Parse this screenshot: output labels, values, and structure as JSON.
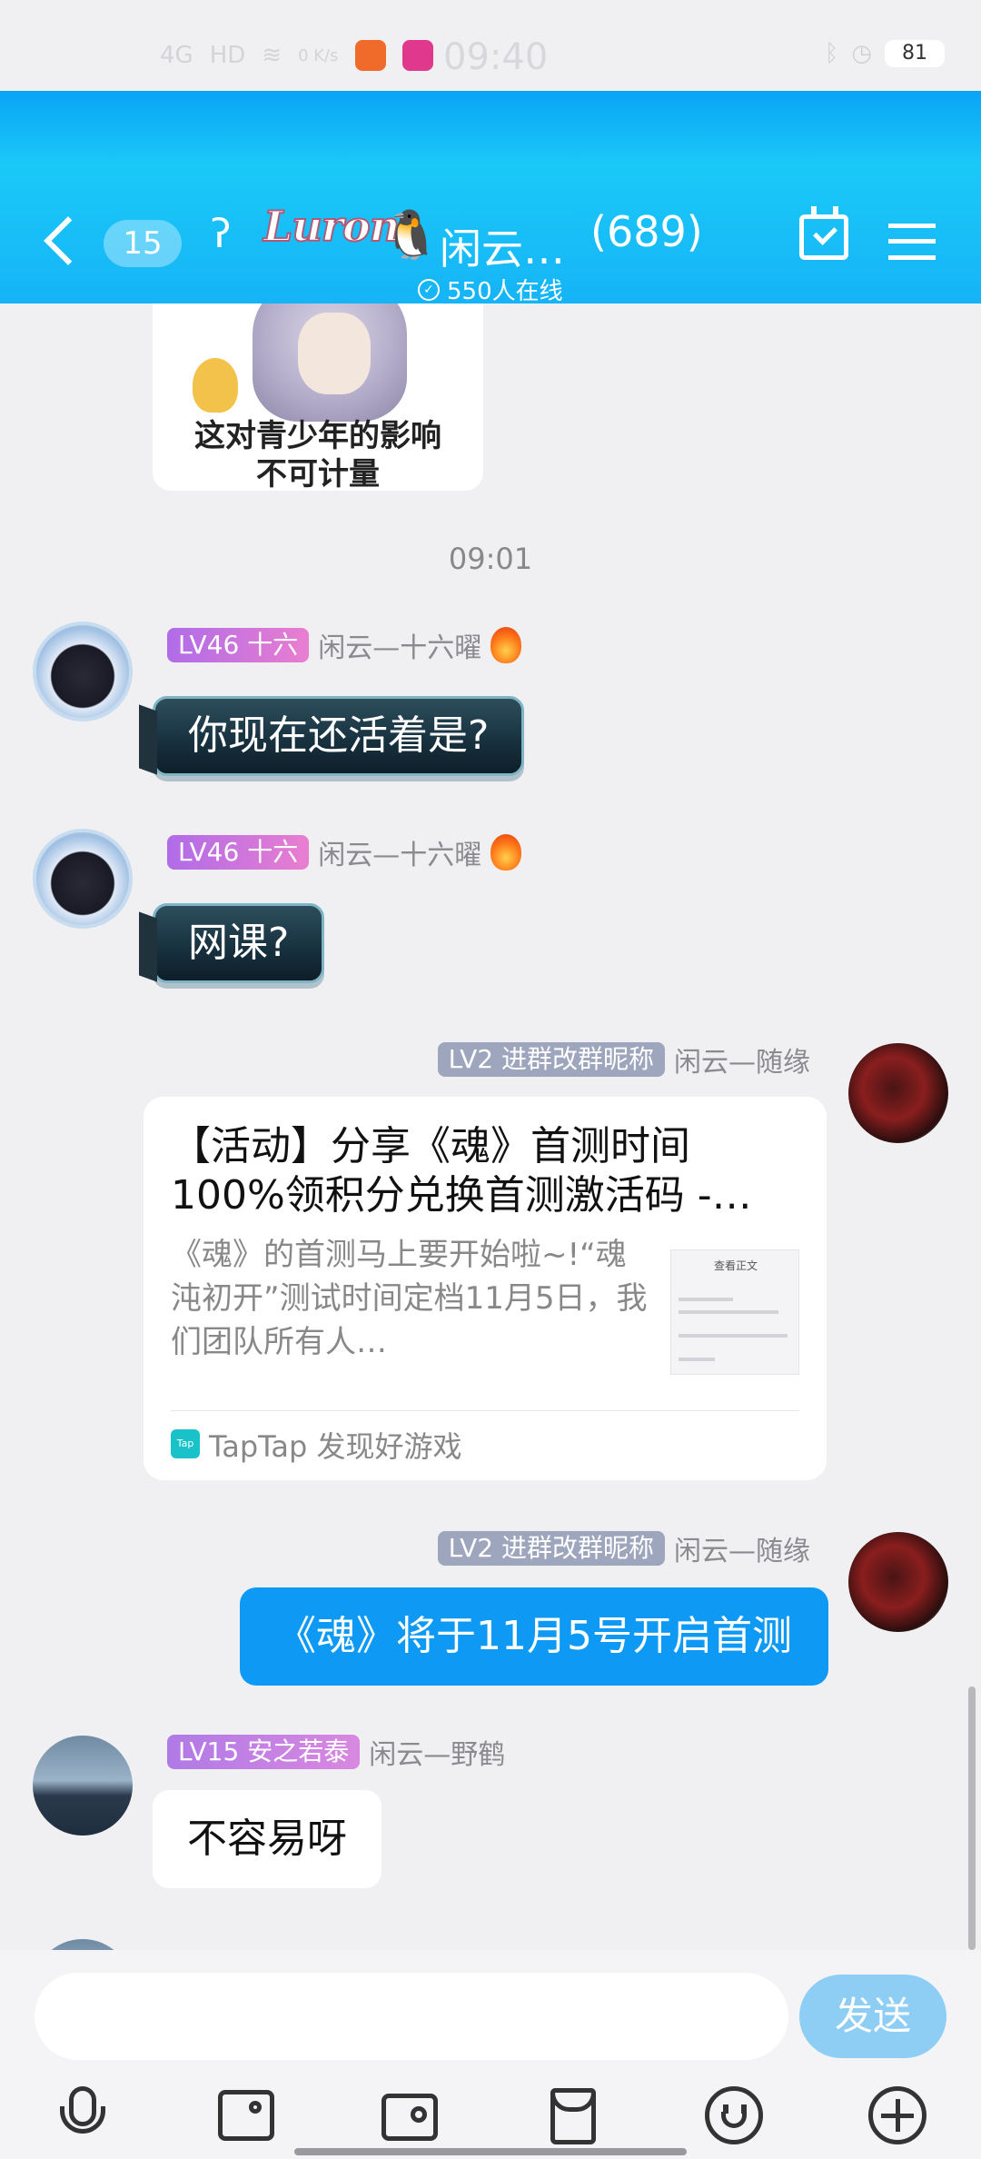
{
  "status_bar": {
    "network": "4G",
    "hd": "HD",
    "data_rate": "0 K/s",
    "time": "09:40",
    "battery": "81"
  },
  "header": {
    "unread_count": "15",
    "group_name": "闲云…",
    "member_count": "(689)",
    "online_text": "550人在线",
    "logo_text": "Luron",
    "colors": {
      "header": "#16b4f6",
      "accent": "#0e99f4"
    }
  },
  "sticker": {
    "line1": "这对青少年的影响",
    "line2": "不可计量"
  },
  "timestamp": "09:01",
  "messages": [
    {
      "level": "LV46",
      "title": "十六",
      "nick": "闲云—十六曜",
      "text": "你现在还活着是?"
    },
    {
      "level": "LV46",
      "title": "十六",
      "nick": "闲云—十六曜",
      "text": "网课?"
    },
    {
      "level": "LV2",
      "title": "进群改群昵称",
      "nick": "闲云—随缘"
    },
    {
      "level": "LV2",
      "title": "进群改群昵称",
      "nick": "闲云—随缘",
      "text": "《魂》将于11月5号开启首测"
    },
    {
      "level": "LV15",
      "title": "安之若泰",
      "nick": "闲云—野鹤",
      "text": "不容易呀"
    }
  ],
  "share_card": {
    "title": "【活动】分享《魂》首测时间100%领积分兑换首测激活码 -…",
    "desc": "《魂》的首测马上要开始啦~!“魂沌初开”测试时间定档11月5日，我们团队所有人…",
    "thumb_title": "查看正文",
    "source_icon": "Tap",
    "source": "TapTap 发现好游戏"
  },
  "input": {
    "placeholder": "",
    "send_label": "发送"
  },
  "toolbar_icons": [
    "microphone-icon",
    "image-icon",
    "camera-icon",
    "red-packet-icon",
    "emoji-icon",
    "plus-icon"
  ]
}
